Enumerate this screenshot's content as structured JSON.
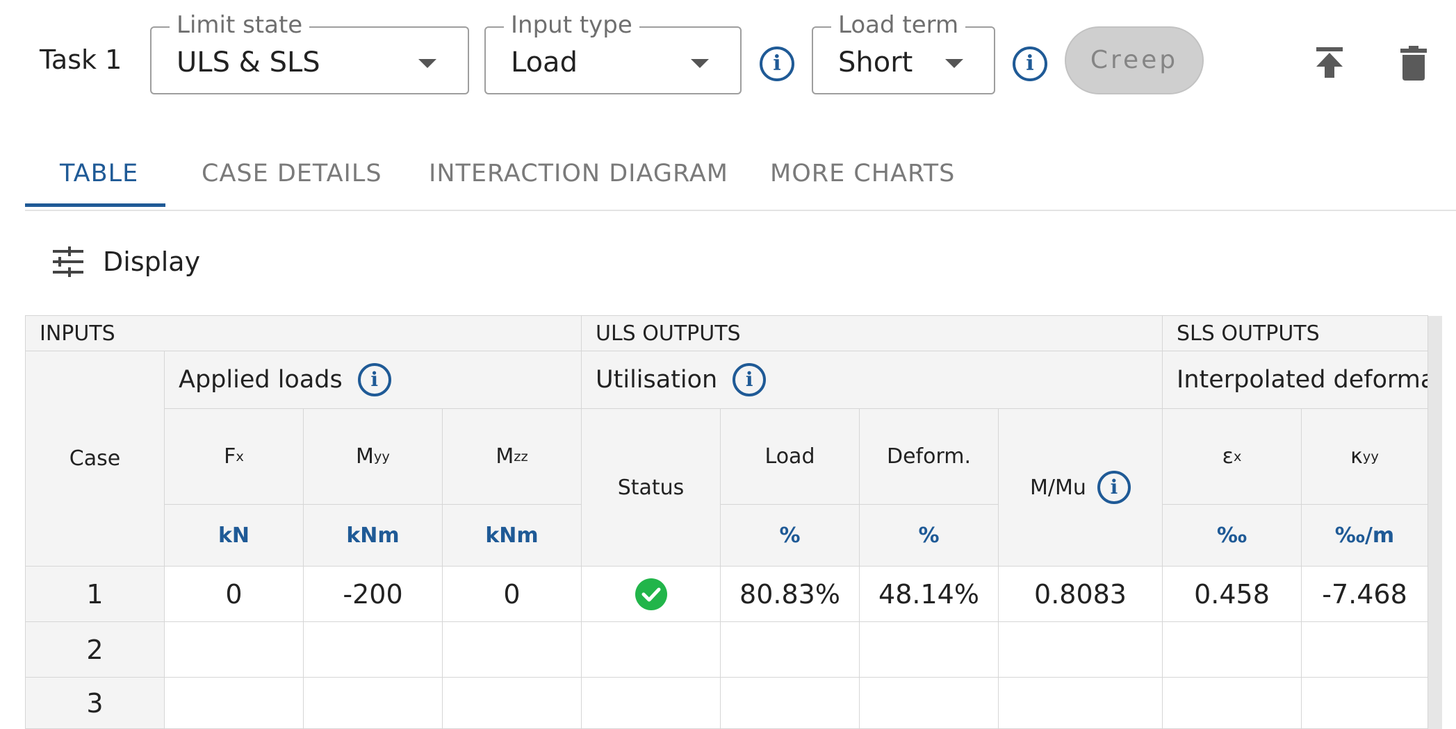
{
  "toolbar": {
    "task_title": "Task 1",
    "limit_state": {
      "legend": "Limit state",
      "value": "ULS & SLS"
    },
    "input_type": {
      "legend": "Input type",
      "value": "Load"
    },
    "load_term": {
      "legend": "Load term",
      "value": "Short"
    },
    "creep_label": "Creep",
    "icons": [
      "info-icon",
      "info-icon",
      "move-to-top-icon",
      "delete-icon"
    ]
  },
  "tabs": [
    {
      "label": "TABLE",
      "active": true
    },
    {
      "label": "CASE DETAILS",
      "active": false
    },
    {
      "label": "INTERACTION DIAGRAM",
      "active": false
    },
    {
      "label": "MORE CHARTS",
      "active": false
    }
  ],
  "display": {
    "label": "Display",
    "icon": "tune-icon"
  },
  "table": {
    "groups": [
      "INPUTS",
      "ULS OUTPUTS",
      "SLS OUTPUTS"
    ],
    "subgroups": [
      "Applied loads",
      "Utilisation",
      "Interpolated deformat"
    ],
    "case_header": "Case",
    "columns": [
      {
        "main": "F",
        "sub": "x",
        "unit": "kN"
      },
      {
        "main": "M",
        "sub": "yy",
        "unit": "kNm"
      },
      {
        "main": "M",
        "sub": "zz",
        "unit": "kNm"
      },
      {
        "main": "Status",
        "sub": "",
        "unit": ""
      },
      {
        "main": "Load",
        "sub": "",
        "unit": "%"
      },
      {
        "main": "Deform.",
        "sub": "",
        "unit": "%"
      },
      {
        "main": "M/Mu",
        "sub": "",
        "unit": ""
      },
      {
        "main": "ε",
        "sub": "x",
        "unit": "‰"
      },
      {
        "main": "κ",
        "sub": "yy",
        "unit": "‰/m"
      }
    ],
    "rows": [
      {
        "case": "1",
        "fx": "0",
        "myy": "-200",
        "mzz": "0",
        "status": "pass",
        "load": "80.83%",
        "deform": "48.14%",
        "m_mu": "0.8083",
        "ex": "0.458",
        "kyy": "-7.468"
      },
      {
        "case": "2",
        "fx": "",
        "myy": "",
        "mzz": "",
        "status": "",
        "load": "",
        "deform": "",
        "m_mu": "",
        "ex": "",
        "kyy": ""
      },
      {
        "case": "3",
        "fx": "",
        "myy": "",
        "mzz": "",
        "status": "",
        "load": "",
        "deform": "",
        "m_mu": "",
        "ex": "",
        "kyy": ""
      }
    ],
    "colors": {
      "accent": "#1f5a96",
      "pass": "#22b54a",
      "header_bg": "#f4f4f4"
    }
  }
}
